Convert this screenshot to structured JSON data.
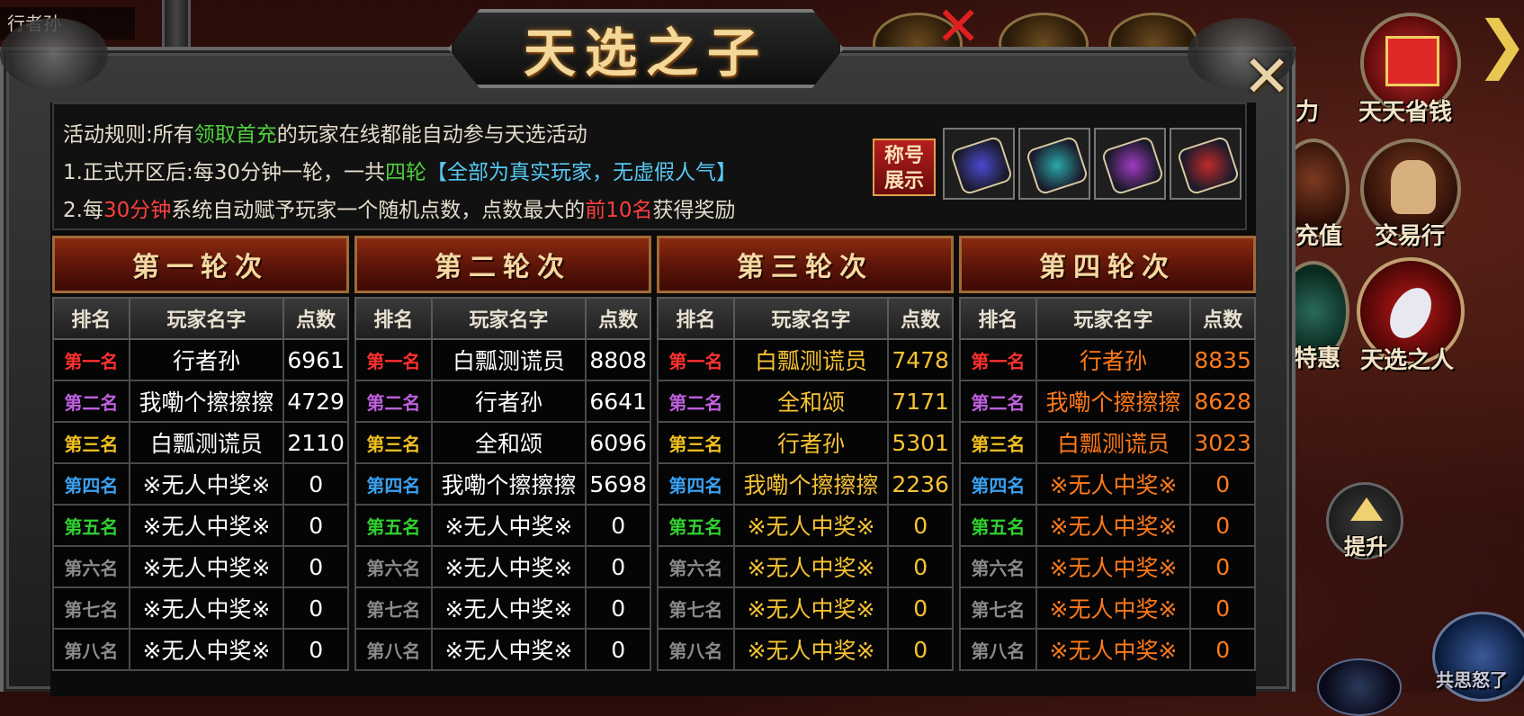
{
  "player": {
    "name": "行者孙"
  },
  "title": "天选之子",
  "close_symbol": "✕",
  "rules": {
    "line1": [
      {
        "text": "活动规则:所有",
        "color": ""
      },
      {
        "text": "领取首充",
        "color": "g"
      },
      {
        "text": "的玩家在线都能自动参与天选活动",
        "color": ""
      }
    ],
    "line2": [
      {
        "text": "1.正式开区后:每30分钟一轮，一共",
        "color": ""
      },
      {
        "text": "四轮",
        "color": "g"
      },
      {
        "text": "【全部为真实玩家，无虚假人气】",
        "color": "b"
      }
    ],
    "line3": [
      {
        "text": "2.每",
        "color": ""
      },
      {
        "text": "30分钟",
        "color": "r"
      },
      {
        "text": "系统自动赋予玩家一个随机点数，点数最大的",
        "color": ""
      },
      {
        "text": "前10名",
        "color": "r"
      },
      {
        "text": "获得奖励",
        "color": ""
      }
    ],
    "title_tag": "称号展示",
    "title_tag_line1": "称号",
    "title_tag_line2": "展示"
  },
  "scrolls": [
    {
      "name": "blue-scroll-icon",
      "color": "#4a4ad0"
    },
    {
      "name": "teal-scroll-icon",
      "color": "#2aa8a8"
    },
    {
      "name": "purple-scroll-icon",
      "color": "#a03ac0"
    },
    {
      "name": "red-scroll-icon",
      "color": "#c02a2a"
    }
  ],
  "columns": {
    "rank": "排名",
    "player": "玩家名字",
    "points": "点数"
  },
  "rank_labels": [
    {
      "text": "第一名",
      "color": "#ff3030"
    },
    {
      "text": "第二名",
      "color": "#c060e0"
    },
    {
      "text": "第三名",
      "color": "#f0c020"
    },
    {
      "text": "第四名",
      "color": "#3aa0f0"
    },
    {
      "text": "第五名",
      "color": "#30d030"
    },
    {
      "text": "第六名",
      "color": "#8a8a8a"
    },
    {
      "text": "第七名",
      "color": "#8a8a8a"
    },
    {
      "text": "第八名",
      "color": "#8a8a8a"
    }
  ],
  "rounds": [
    {
      "label": "第一轮次",
      "text_color": "#ffffff",
      "rows": [
        {
          "player": "行者孙",
          "points": "6961"
        },
        {
          "player": "我嘞个擦擦擦",
          "points": "4729"
        },
        {
          "player": "白瓢测谎员",
          "points": "2110"
        },
        {
          "player": "※无人中奖※",
          "points": "0"
        },
        {
          "player": "※无人中奖※",
          "points": "0"
        },
        {
          "player": "※无人中奖※",
          "points": "0"
        },
        {
          "player": "※无人中奖※",
          "points": "0"
        },
        {
          "player": "※无人中奖※",
          "points": "0"
        }
      ]
    },
    {
      "label": "第二轮次",
      "text_color": "#ffffff",
      "rows": [
        {
          "player": "白瓢测谎员",
          "points": "8808"
        },
        {
          "player": "行者孙",
          "points": "6641"
        },
        {
          "player": "全和颂",
          "points": "6096"
        },
        {
          "player": "我嘞个擦擦擦",
          "points": "5698"
        },
        {
          "player": "※无人中奖※",
          "points": "0"
        },
        {
          "player": "※无人中奖※",
          "points": "0"
        },
        {
          "player": "※无人中奖※",
          "points": "0"
        },
        {
          "player": "※无人中奖※",
          "points": "0"
        }
      ]
    },
    {
      "label": "第三轮次",
      "text_color": "#f7c233",
      "rows": [
        {
          "player": "白瓢测谎员",
          "points": "7478"
        },
        {
          "player": "全和颂",
          "points": "7171"
        },
        {
          "player": "行者孙",
          "points": "5301"
        },
        {
          "player": "我嘞个擦擦擦",
          "points": "2236"
        },
        {
          "player": "※无人中奖※",
          "points": "0"
        },
        {
          "player": "※无人中奖※",
          "points": "0"
        },
        {
          "player": "※无人中奖※",
          "points": "0"
        },
        {
          "player": "※无人中奖※",
          "points": "0"
        }
      ]
    },
    {
      "label": "第四轮次",
      "text_color": "#ff7a1a",
      "rows": [
        {
          "player": "行者孙",
          "points": "8835"
        },
        {
          "player": "我嘞个擦擦擦",
          "points": "8628"
        },
        {
          "player": "白瓢测谎员",
          "points": "3023"
        },
        {
          "player": "※无人中奖※",
          "points": "0"
        },
        {
          "player": "※无人中奖※",
          "points": "0"
        },
        {
          "player": "※无人中奖※",
          "points": "0"
        },
        {
          "player": "※无人中奖※",
          "points": "0"
        },
        {
          "player": "※无人中奖※",
          "points": "0"
        }
      ]
    }
  ],
  "side_buttons": [
    {
      "label": "天天省钱",
      "name": "save-money-button"
    },
    {
      "label": "交易行",
      "name": "trading-house-button"
    },
    {
      "label": "天选之人",
      "name": "chosen-one-button"
    }
  ],
  "side_partial_labels": [
    "充值",
    "特惠"
  ],
  "partial_label_top": "力",
  "up_button_label": "提升",
  "bottom_right_text": "共思怒了"
}
